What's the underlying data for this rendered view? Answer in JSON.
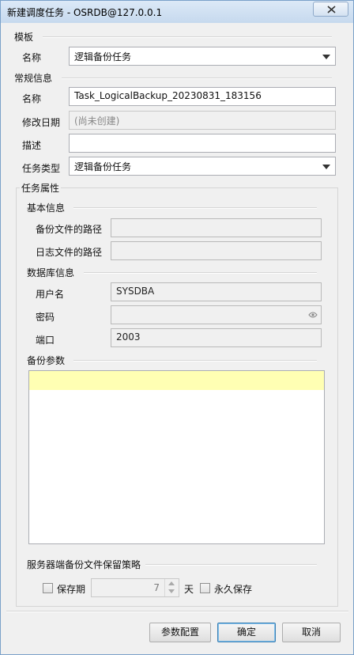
{
  "window": {
    "title": "新建调度任务 - OSRDB@127.0.0.1"
  },
  "template": {
    "section_label": "模板",
    "name_label": "名称",
    "name_value": "逻辑备份任务"
  },
  "general": {
    "section_label": "常规信息",
    "name_label": "名称",
    "name_value": "Task_LogicalBackup_20230831_183156",
    "modified_label": "修改日期",
    "modified_value": "(尚未创建)",
    "desc_label": "描述",
    "desc_value": "",
    "type_label": "任务类型",
    "type_value": "逻辑备份任务"
  },
  "properties": {
    "group_label": "任务属性",
    "basic_label": "基本信息",
    "backup_path_label": "备份文件的路径",
    "backup_path_value": "",
    "log_path_label": "日志文件的路径",
    "log_path_value": "",
    "db_label": "数据库信息",
    "user_label": "用户名",
    "user_value": "SYSDBA",
    "password_label": "密码",
    "password_value": "",
    "port_label": "端口",
    "port_value": "2003",
    "params_label": "备份参数",
    "retention_label": "服务器端备份文件保留策略",
    "keep_period_label": "保存期",
    "keep_days_value": "7",
    "days_unit": "天",
    "forever_label": "永久保存"
  },
  "buttons": {
    "params_config": "参数配置",
    "ok": "确定",
    "cancel": "取消"
  },
  "icons": {
    "close": "close-icon",
    "eye": "eye-icon",
    "combo_arrow": "chevron-down-icon"
  },
  "colors": {
    "highlight_line": "#ffffb3",
    "default_button_border": "#3c7fb1"
  }
}
